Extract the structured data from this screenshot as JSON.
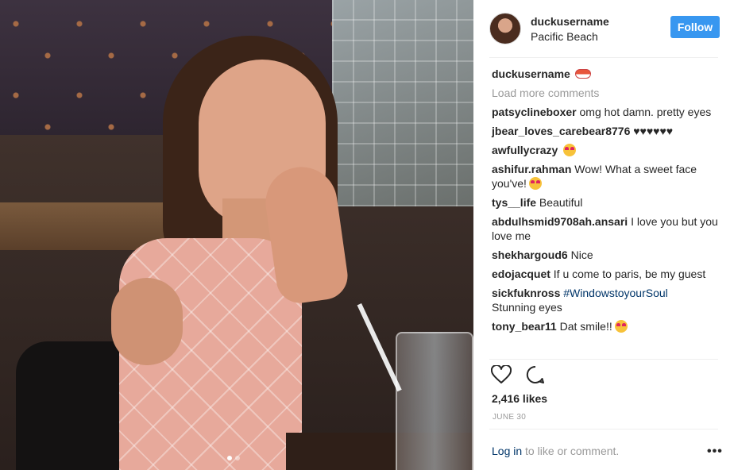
{
  "post": {
    "username": "duckusername",
    "location": "Pacific Beach",
    "follow_label": "Follow",
    "caption_user": "duckusername",
    "caption_icon": "sushi-emoji",
    "load_more": "Load more comments",
    "likes": "2,416 likes",
    "date": "JUNE 30",
    "login_link": "Log in",
    "login_suffix": " to like or comment.",
    "more_label": "•••"
  },
  "comments": [
    {
      "user": "patsyclineboxer",
      "text": " omg hot damn. pretty eyes"
    },
    {
      "user": "jbear_loves_carebear8776",
      "text": " ♥♥♥♥♥♥"
    },
    {
      "user": "awfullycrazy",
      "text": " ",
      "emoji": "heart-eyes-emoji"
    },
    {
      "user": "ashifur.rahman",
      "text": " Wow! What a sweet face you've!",
      "emoji": "heart-eyes-emoji"
    },
    {
      "user": "tys__life",
      "text": " Beautiful"
    },
    {
      "user": "abdulhsmid9708ah.ansari",
      "text": " I love you but you love me"
    },
    {
      "user": "shekhargoud6",
      "text": " Nice"
    },
    {
      "user": "edojacquet",
      "text": " If u come to paris, be my guest"
    },
    {
      "user": "sickfuknross",
      "text": " Stunning eyes",
      "hashtag": "#WindowstoyourSoul"
    },
    {
      "user": "tony_bear11",
      "text": " Dat smile!!",
      "emoji": "heart-eyes-emoji"
    }
  ],
  "colors": {
    "follow_button": "#3897f0",
    "link": "#003569",
    "muted": "#999999"
  },
  "icons": {
    "like": "heart-outline-icon",
    "comment": "speech-bubble-icon"
  },
  "carousel": {
    "count": 2,
    "active_index": 1
  }
}
